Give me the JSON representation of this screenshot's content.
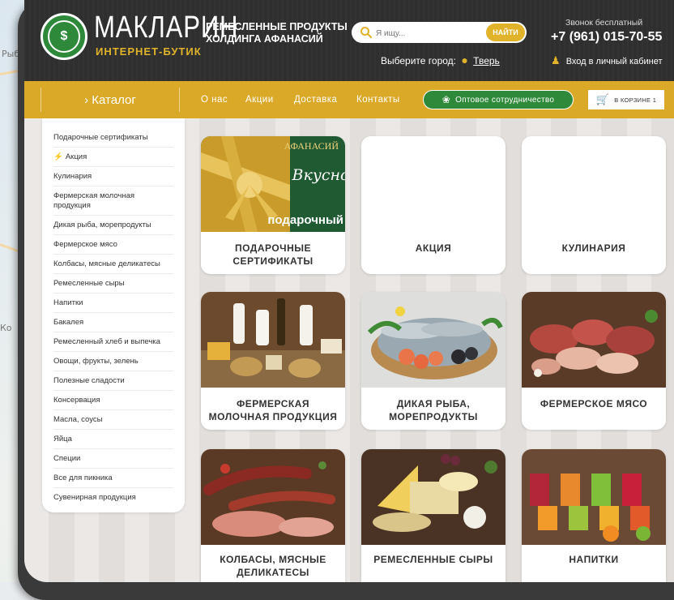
{
  "map": {
    "labels": [
      "Рыб",
      "Ко"
    ]
  },
  "header": {
    "brand": "МАКЛАРИН",
    "brand_sub": "ИНТЕРНЕТ-БУТИК",
    "tagline_line1": "РЕМЕСЛЕННЫЕ ПРОДУКТЫ",
    "tagline_line2": "ХОЛДИНГА АФАНАСИЙ",
    "search_placeholder": "Я ищу...",
    "search_button": "НАЙТИ",
    "city_label": "Выберите город:",
    "city_value": "Тверь",
    "call_label": "Звонок бесплатный",
    "phone": "+7 (961) 015-70-55",
    "login": "Вход в личный кабинет"
  },
  "nav": {
    "catalog": "› Каталог",
    "links": [
      "О нас",
      "Акции",
      "Доставка",
      "Контакты"
    ],
    "wholesale": "Оптовое сотрудничество",
    "cart": "В КОРЗИНЕ 1"
  },
  "sidebar": {
    "items": [
      "Подарочные сертификаты",
      "Акция",
      "Кулинария",
      "Фермерская молочная продукция",
      "Дикая рыба, морепродукты",
      "Фермерское мясо",
      "Колбасы, мясные деликатесы",
      "Ремесленные сыры",
      "Напитки",
      "Бакалея",
      "Ремесленный хлеб и выпечка",
      "Овощи, фрукты, зелень",
      "Полезные сладости",
      "Консервация",
      "Масла, соусы",
      "Яйца",
      "Специи",
      "Все для пикника",
      "Сувенирная продукция"
    ]
  },
  "cards": [
    {
      "title": "ПОДАРОЧНЫЕ СЕРТИФИКАТЫ",
      "banner_brand": "АФАНАСИЙ",
      "banner_script": "Вкусно",
      "banner_tag": "подарочный"
    },
    {
      "title": "АКЦИЯ"
    },
    {
      "title": "КУЛИНАРИЯ"
    },
    {
      "title": "ФЕРМЕРСКАЯ МОЛОЧНАЯ ПРОДУКЦИЯ"
    },
    {
      "title": "ДИКАЯ РЫБА, МОРЕПРОДУКТЫ"
    },
    {
      "title": "ФЕРМЕРСКОЕ МЯСО"
    },
    {
      "title": "КОЛБАСЫ, МЯСНЫЕ ДЕЛИКАТЕСЫ"
    },
    {
      "title": "РЕМЕСЛЕННЫЕ СЫРЫ"
    },
    {
      "title": "НАПИТКИ"
    }
  ]
}
